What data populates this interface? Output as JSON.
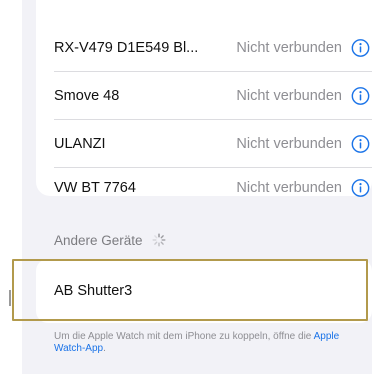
{
  "paired_devices": [
    {
      "name": "RX-V479 D1E549 Bl...",
      "status": "Nicht verbunden",
      "icon": "info-circle-icon"
    },
    {
      "name": "Smove 48",
      "status": "Nicht verbunden",
      "icon": "info-circle-icon"
    },
    {
      "name": "ULANZI",
      "status": "Nicht verbunden",
      "icon": "info-circle-icon"
    },
    {
      "name": "VW BT 7764",
      "status": "Nicht verbunden",
      "icon": "info-circle-icon"
    }
  ],
  "other_devices": {
    "header": "Andere Geräte",
    "items": [
      {
        "name": "AB Shutter3"
      }
    ]
  },
  "footer": {
    "text": "Um die Apple Watch mit dem iPhone zu koppeln, öffne die ",
    "link": "Apple Watch-App",
    "suffix": "."
  },
  "colors": {
    "accent": "#1a73e8",
    "highlight": "#b29a4c",
    "secondary_text": "#8e8e93"
  }
}
